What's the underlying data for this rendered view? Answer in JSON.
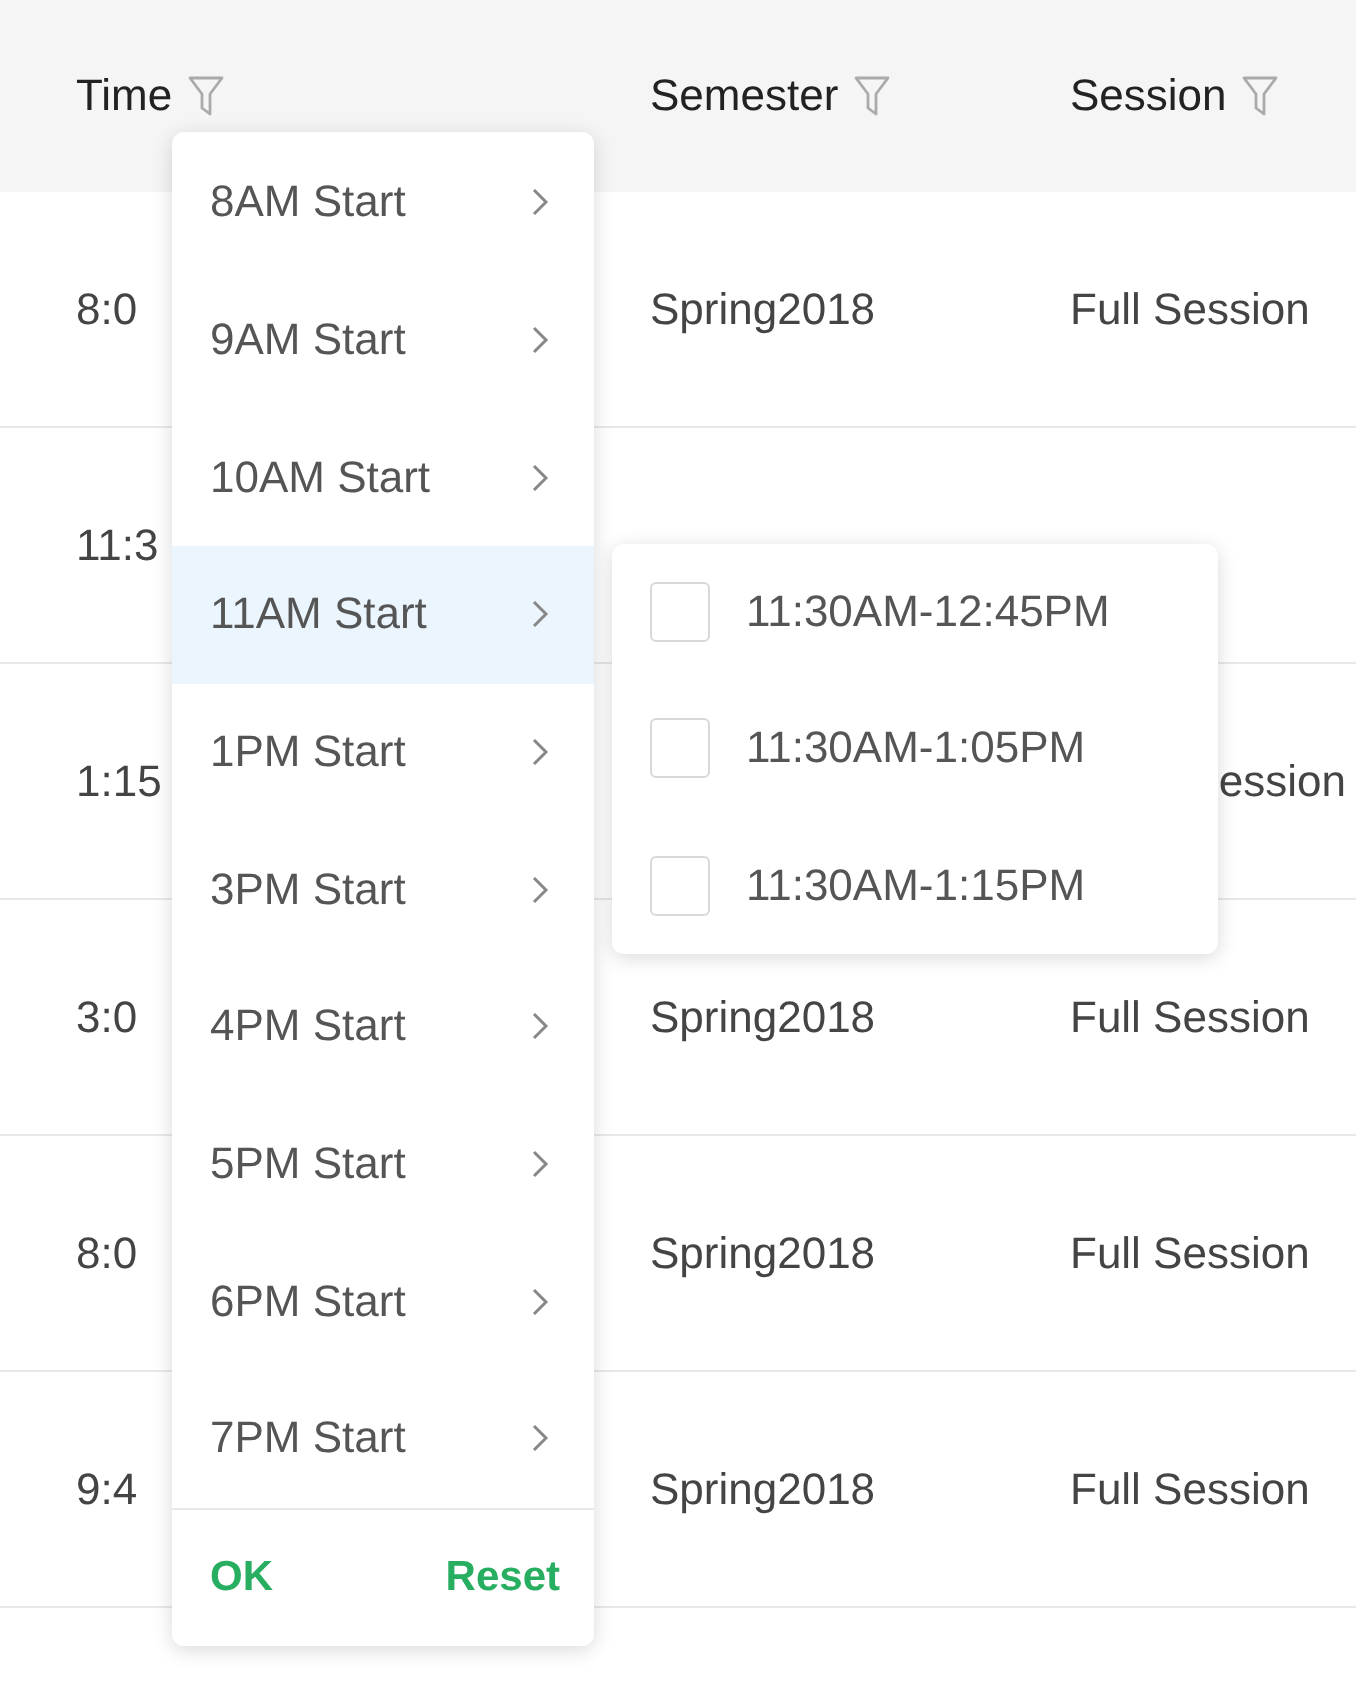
{
  "columns": [
    {
      "label": "Time"
    },
    {
      "label": "Semester"
    },
    {
      "label": "Session"
    }
  ],
  "rows": [
    {
      "time": "8:0",
      "semester": "Spring2018",
      "session": "Full Session"
    },
    {
      "time": "11:3"
    },
    {
      "time": "1:15",
      "session": "ession"
    },
    {
      "time": "3:0",
      "semester": "Spring2018",
      "session": "Full Session"
    },
    {
      "time": "8:0",
      "semester": "Spring2018",
      "session": "Full Session"
    },
    {
      "time": "9:4",
      "semester": "Spring2018",
      "session": "Full Session"
    }
  ],
  "filter_menu": {
    "items": [
      {
        "label": "8AM Start",
        "selected": false
      },
      {
        "label": "9AM Start",
        "selected": false
      },
      {
        "label": "10AM Start",
        "selected": false
      },
      {
        "label": "11AM Start",
        "selected": true
      },
      {
        "label": "1PM Start",
        "selected": false
      },
      {
        "label": "3PM Start",
        "selected": false
      },
      {
        "label": "4PM Start",
        "selected": false
      },
      {
        "label": "5PM Start",
        "selected": false
      },
      {
        "label": "6PM Start",
        "selected": false
      },
      {
        "label": "7PM Start",
        "selected": false
      }
    ],
    "submenu": {
      "options": [
        {
          "label": "11:30AM-12:45PM",
          "checked": false
        },
        {
          "label": "11:30AM-1:05PM",
          "checked": false
        },
        {
          "label": "11:30AM-1:15PM",
          "checked": false
        }
      ]
    },
    "ok": "OK",
    "reset": "Reset"
  }
}
